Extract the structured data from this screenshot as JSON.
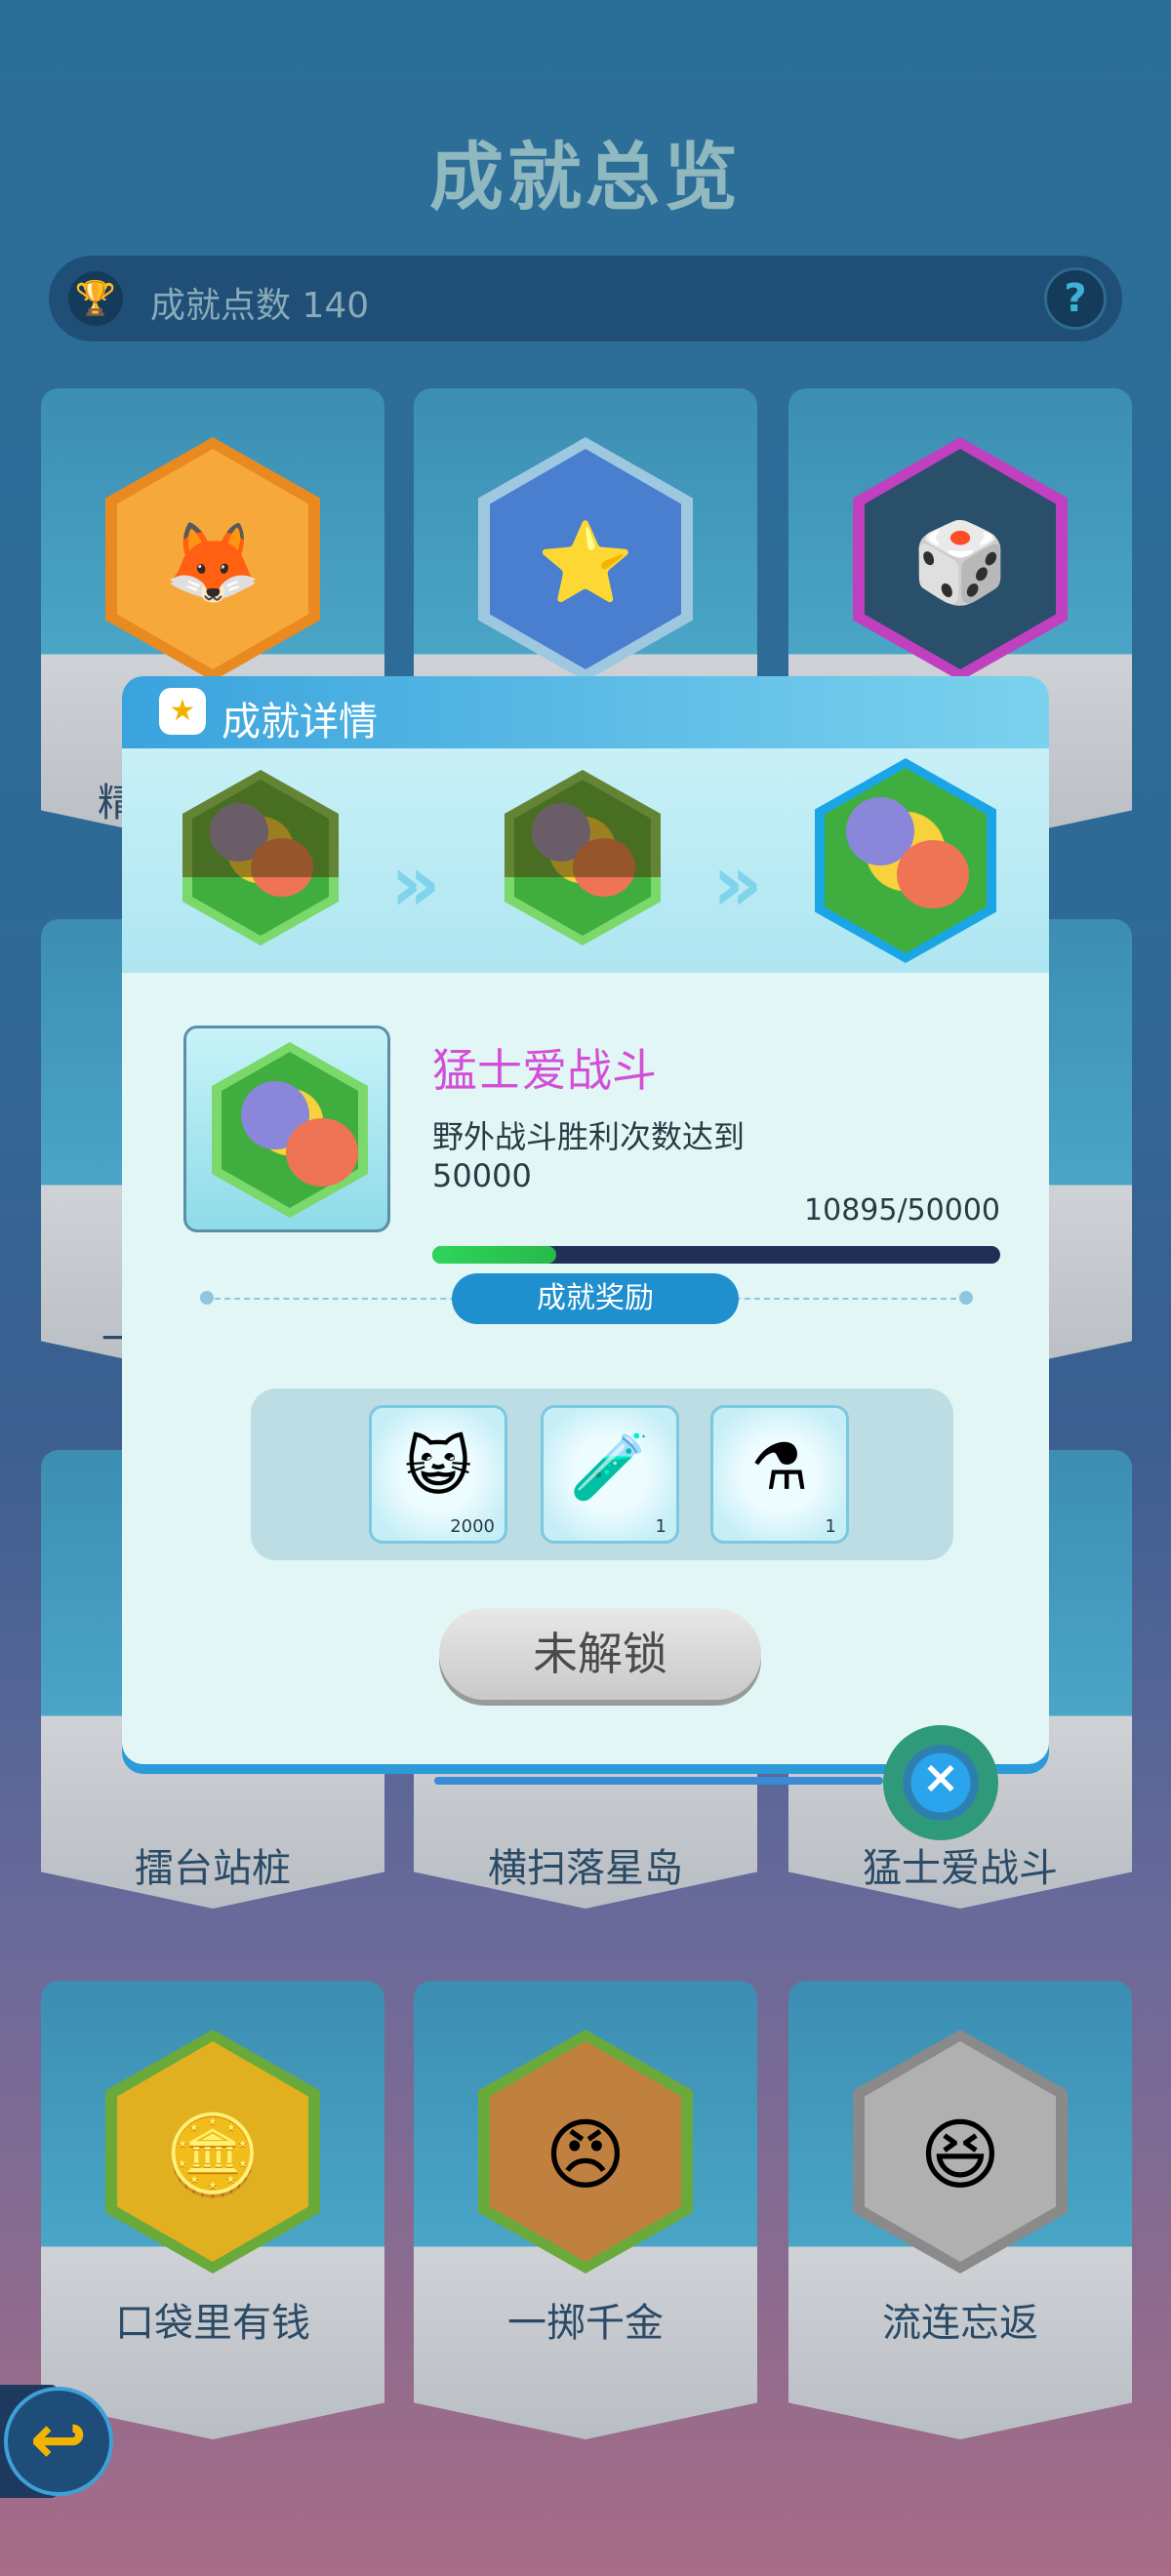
{
  "page": {
    "title": "成就总览",
    "points_label": "成就点数 140",
    "help_label": "?"
  },
  "grid": {
    "cards": [
      {
        "label": "",
        "glyph": "🦊",
        "color": "#f0a020"
      },
      {
        "label": "",
        "glyph": "⭐",
        "color": "#4a7fd0"
      },
      {
        "label": "",
        "glyph": "🎲",
        "color": "#c040c0"
      },
      {
        "label": "擂台站桩",
        "glyph": "",
        "color": "#6a7a8a"
      },
      {
        "label": "横扫落星岛",
        "glyph": "",
        "color": "#6a7a8a"
      },
      {
        "label": "猛士爱战斗",
        "glyph": "",
        "color": "#6a7a8a"
      },
      {
        "label": "口袋里有钱",
        "glyph": "🪙",
        "color": "#e0b020"
      },
      {
        "label": "一掷千金",
        "glyph": "😠",
        "color": "#c08040"
      },
      {
        "label": "流连忘返",
        "glyph": "😆",
        "color": "#9a9a9a"
      }
    ],
    "partial_labels": {
      "left_col_row1": "精",
      "left_col_row2": "一"
    }
  },
  "modal": {
    "title": "成就详情",
    "achievement_name": "猛士爱战斗",
    "description": "野外战斗胜利次数达到50000",
    "progress_text": "10895/50000",
    "progress_value": 10895,
    "progress_max": 50000,
    "progress_fraction": 0.218,
    "rewards_label": "成就奖励",
    "rewards": [
      {
        "icon": "cat-face-icon",
        "glyph": "😺",
        "count": "2000"
      },
      {
        "icon": "purple-potion-icon",
        "glyph": "🧪",
        "count": "1"
      },
      {
        "icon": "red-potion-icon",
        "glyph": "⚗",
        "count": "1"
      }
    ],
    "locked_label": "未解锁",
    "close_label": "×",
    "stages": [
      "stage-1",
      "stage-2",
      "stage-3"
    ]
  },
  "nav": {
    "back_label": "↩"
  },
  "colors": {
    "accent": "#2b9ad8",
    "name_color": "#d24fd6",
    "progress_fill": "#2ed65a"
  }
}
